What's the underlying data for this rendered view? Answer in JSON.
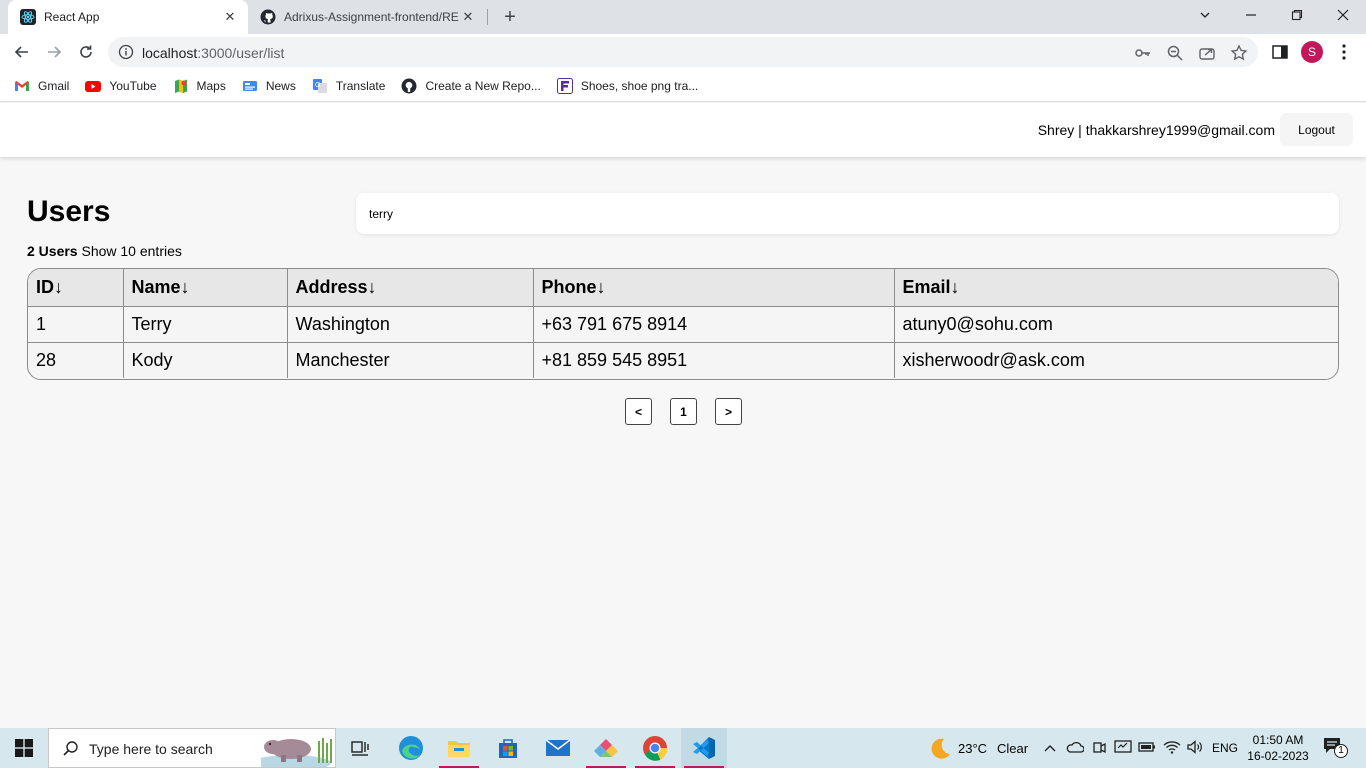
{
  "browser": {
    "tabs": [
      {
        "title": "React App",
        "active": true
      },
      {
        "title": "Adrixus-Assignment-frontend/RE",
        "active": false
      }
    ],
    "address": {
      "host": "localhost",
      "port_path": ":3000/user/list"
    },
    "bookmarks": [
      {
        "label": "Gmail",
        "icon": "gmail-icon"
      },
      {
        "label": "YouTube",
        "icon": "youtube-icon"
      },
      {
        "label": "Maps",
        "icon": "maps-icon"
      },
      {
        "label": "News",
        "icon": "news-icon"
      },
      {
        "label": "Translate",
        "icon": "translate-icon"
      },
      {
        "label": "Create a New Repo...",
        "icon": "github-icon"
      },
      {
        "label": "Shoes, shoe png tra...",
        "icon": "shoes-icon"
      }
    ],
    "profile_initial": "S"
  },
  "navbar": {
    "user_info": "Shrey | thakkarshrey1999@gmail.com",
    "logout_label": "Logout"
  },
  "main": {
    "title": "Users",
    "search_value": "terry",
    "summary_count": "2 Users",
    "summary_text": " Show 10 entries"
  },
  "table": {
    "headers": [
      {
        "label": "ID",
        "arrow": "↓"
      },
      {
        "label": "Name",
        "arrow": "↓"
      },
      {
        "label": "Address",
        "arrow": "↓"
      },
      {
        "label": "Phone",
        "arrow": "↓"
      },
      {
        "label": "Email",
        "arrow": "↓"
      }
    ],
    "rows": [
      [
        "1",
        "Terry",
        "Washington",
        "+63 791 675 8914",
        "atuny0@sohu.com"
      ],
      [
        "28",
        "Kody",
        "Manchester",
        "+81 859 545 8951",
        "xisherwoodr@ask.com"
      ]
    ]
  },
  "pagination": {
    "prev": "<",
    "current": "1",
    "next": ">"
  },
  "taskbar": {
    "search_placeholder": "Type here to search",
    "weather_temp": "23°C",
    "weather_desc": "Clear",
    "language": "ENG",
    "time": "01:50 AM",
    "date": "16-02-2023",
    "notification_count": "1"
  },
  "colors": {
    "accent_profile": "#c2185b",
    "taskbar": "#d6e8ee",
    "header_row": "#e7e7e7"
  }
}
